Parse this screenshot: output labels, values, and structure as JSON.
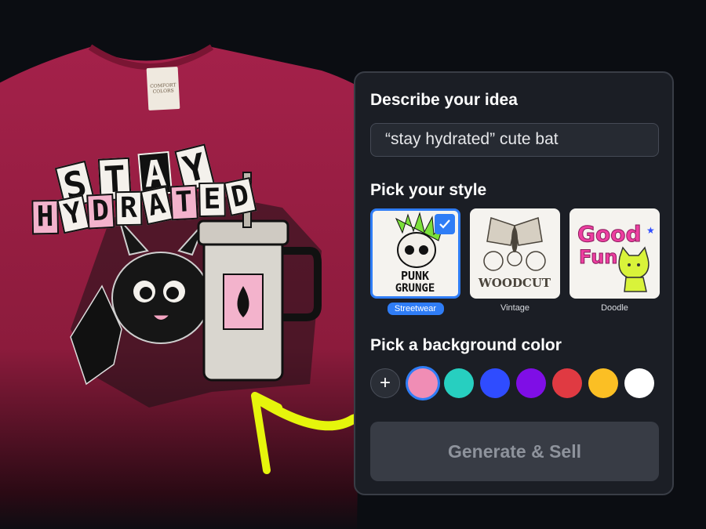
{
  "shirt": {
    "neck_tag": [
      "COMFORT",
      "COLORS"
    ],
    "design_words": {
      "stay": [
        "S",
        "T",
        "A",
        "Y"
      ],
      "hydrated": [
        "H",
        "Y",
        "D",
        "R",
        "A",
        "T",
        "E",
        "D"
      ]
    },
    "cup_mark": "▲"
  },
  "panel": {
    "idea_title": "Describe your idea",
    "idea_value": "“stay hydrated” cute bat",
    "style_title": "Pick your style",
    "styles": [
      {
        "label": "Streetwear",
        "thumb_text": "PUNK GRUNGE",
        "selected": true
      },
      {
        "label": "Vintage",
        "thumb_text": "WOODCUT",
        "selected": false
      },
      {
        "label": "Doodle",
        "thumb_text": "Good Fun",
        "selected": false
      }
    ],
    "color_title": "Pick a background color",
    "add_color_label": "+",
    "colors": [
      "#f08db5",
      "#27cfc0",
      "#2f4cff",
      "#7f0ee6",
      "#e03a42",
      "#fbbf24",
      "#ffffff"
    ],
    "selected_color": "#f08db5",
    "generate_label": "Generate & Sell"
  },
  "colors": {
    "shirt": "#9a1e3f",
    "accent_blue": "#2f7df6",
    "arrow": "#e6f50c",
    "panel_bg": "#1b1e25"
  }
}
